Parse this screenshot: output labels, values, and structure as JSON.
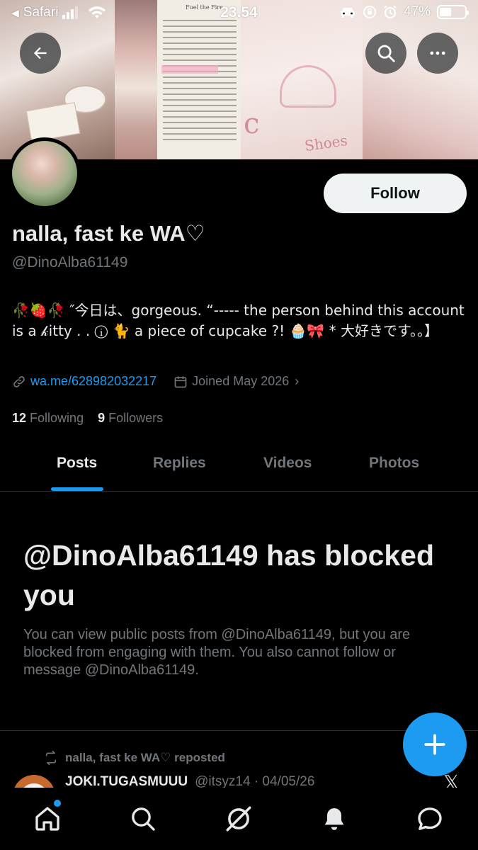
{
  "status_bar": {
    "back_app": "Safari",
    "time": "23.54",
    "battery": "47%",
    "battery_level": 0.47
  },
  "profile": {
    "display_name": "nalla, fast ke WA♡",
    "handle": "@DinoAlba61149",
    "follow_label": "Follow",
    "bio": "🥀🍓🥀 ″今日は、gorgeous. “----- the person behind this account is a 𝓀itty . . ⓘ 🐈 a piece of cupcake ?! 🧁🎀 * 大好きです。。】",
    "website": "wa.me/628982032217",
    "joined": "Joined May 2026",
    "following_count": "12",
    "following_label": "Following",
    "followers_count": "9",
    "followers_label": "Followers"
  },
  "banner": {
    "book_title": "Fuel the Fire"
  },
  "tabs": [
    {
      "label": "Posts",
      "active": true
    },
    {
      "label": "Replies",
      "active": false
    },
    {
      "label": "Videos",
      "active": false
    },
    {
      "label": "Photos",
      "active": false
    }
  ],
  "blocked": {
    "title": "@DinoAlba61149 has blocked you",
    "description": "You can view public posts from @DinoAlba61149, but you are blocked from engaging with them. You also cannot follow or message @DinoAlba61149."
  },
  "post": {
    "repost_text": "nalla, fast ke WA♡ reposted",
    "author_name": "JOKI.TUGASMUUU",
    "author_handle": "@itsyz14 · 04/05/26"
  },
  "bottom_nav": [
    "home-icon",
    "search-icon",
    "grok-icon",
    "notifications-icon",
    "messages-icon"
  ],
  "colors": {
    "accent": "#1d9bf0",
    "background": "#000000",
    "text_primary": "#e7e9ea",
    "text_secondary": "#71767b"
  }
}
